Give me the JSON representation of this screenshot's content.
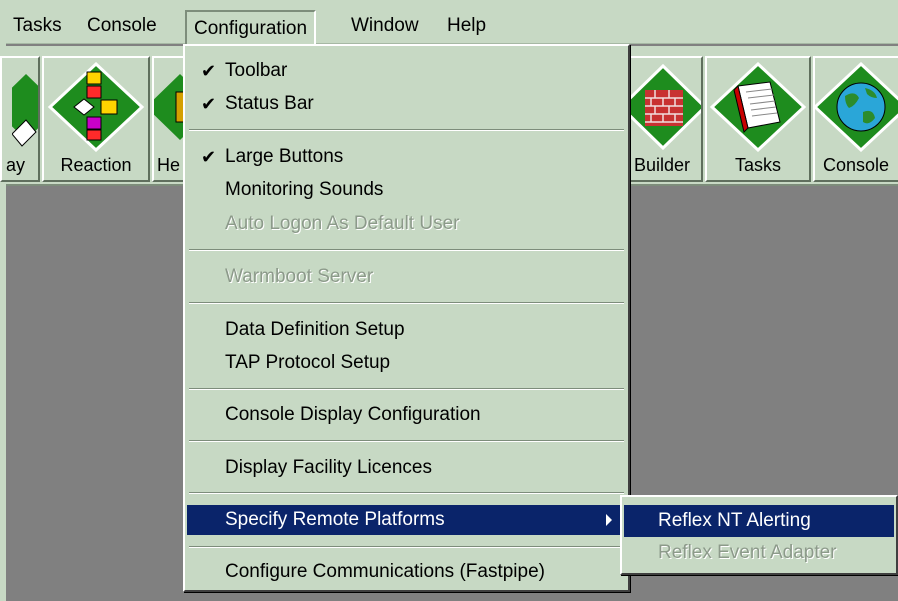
{
  "menubar": {
    "items": [
      {
        "label": "Tasks"
      },
      {
        "label": "Console"
      },
      {
        "label": "Configuration"
      },
      {
        "label": "Window"
      },
      {
        "label": "Help"
      }
    ]
  },
  "toolbar": {
    "buttons": [
      {
        "label": "ay",
        "icon": "display-icon"
      },
      {
        "label": "Reaction",
        "icon": "reaction-icon"
      },
      {
        "label": "He",
        "icon": "health-icon"
      },
      {
        "label": "Builder",
        "icon": "builder-icon"
      },
      {
        "label": "Tasks",
        "icon": "tasks-book-icon"
      },
      {
        "label": "Console",
        "icon": "console-globe-icon"
      }
    ]
  },
  "config_menu": {
    "items": [
      {
        "label": "Toolbar",
        "checked": true
      },
      {
        "label": "Status Bar",
        "checked": true
      },
      {
        "label": "Large Buttons",
        "checked": true
      },
      {
        "label": "Monitoring Sounds"
      },
      {
        "label": "Auto Logon As Default User",
        "disabled": true
      },
      {
        "label": "Warmboot Server",
        "disabled": true
      },
      {
        "label": "Data Definition Setup"
      },
      {
        "label": "TAP Protocol Setup"
      },
      {
        "label": "Console Display Configuration"
      },
      {
        "label": "Display Facility Licences"
      },
      {
        "label": "Specify Remote Platforms",
        "highlighted": true,
        "has_submenu": true
      },
      {
        "label": "Configure Communications (Fastpipe)"
      }
    ],
    "check_glyph": "✔"
  },
  "submenu": {
    "items": [
      {
        "label": "Reflex NT Alerting",
        "highlighted": true
      },
      {
        "label": "Reflex Event Adapter",
        "disabled": true
      }
    ]
  },
  "colors": {
    "menu_bg": "#c7d9c4",
    "highlight": "#0a246a",
    "workspace": "#808080",
    "diamond_green": "#1e8c1e"
  }
}
